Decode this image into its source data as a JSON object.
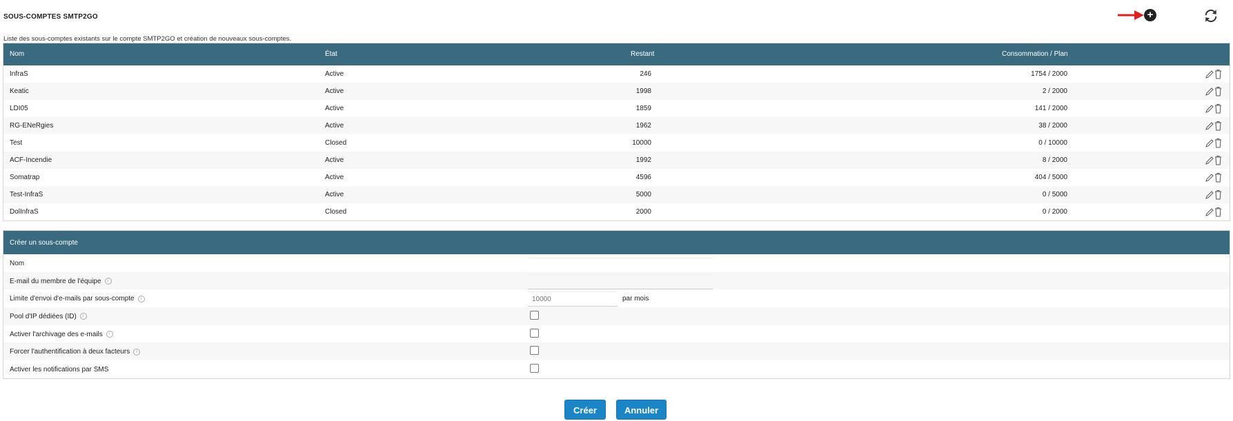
{
  "header": {
    "title": "SOUS-COMPTES SMTP2GO",
    "subtitle": "Liste des sous-comptes existants sur le compte SMTP2GO et création de nouveaux sous-comptes.",
    "add_icon": "+"
  },
  "accounts": {
    "columns": {
      "nom": "Nom",
      "etat": "État",
      "restant": "Restant",
      "conso": "Consommation / Plan"
    },
    "rows": [
      {
        "nom": "InfraS",
        "etat": "Active",
        "restant": "246",
        "conso": "1754 / 2000"
      },
      {
        "nom": "Keatic",
        "etat": "Active",
        "restant": "1998",
        "conso": "2 / 2000"
      },
      {
        "nom": "LDI05",
        "etat": "Active",
        "restant": "1859",
        "conso": "141 / 2000"
      },
      {
        "nom": "RG-ENeRgies",
        "etat": "Active",
        "restant": "1962",
        "conso": "38 / 2000"
      },
      {
        "nom": "Test",
        "etat": "Closed",
        "restant": "10000",
        "conso": "0 / 10000"
      },
      {
        "nom": "ACF-Incendie",
        "etat": "Active",
        "restant": "1992",
        "conso": "8 / 2000"
      },
      {
        "nom": "Somatrap",
        "etat": "Active",
        "restant": "4596",
        "conso": "404 / 5000"
      },
      {
        "nom": "Test-InfraS",
        "etat": "Active",
        "restant": "5000",
        "conso": "0 / 5000"
      },
      {
        "nom": "DolInfraS",
        "etat": "Closed",
        "restant": "2000",
        "conso": "0 / 2000"
      }
    ]
  },
  "create_form": {
    "title": "Créer un sous-compte",
    "nom_label": "Nom",
    "nom_value": "",
    "email_label": "E-mail du membre de l'équipe",
    "email_value": "",
    "limit_label": "Limite d'envoi d'e-mails par sous-compte",
    "limit_placeholder": "10000",
    "limit_suffix": "par mois",
    "pool_label": "Pool d'IP dédiées (ID)",
    "archive_label": "Activer l'archivage des e-mails",
    "twofa_label": "Forcer l'authentification à deux facteurs",
    "sms_label": "Activer les notifications par SMS",
    "info_glyph": "i"
  },
  "buttons": {
    "create": "Créer",
    "cancel": "Annuler"
  },
  "colors": {
    "header_bg": "#3a6a80",
    "button_bg": "#1a86c8",
    "arrow": "#e02020"
  }
}
